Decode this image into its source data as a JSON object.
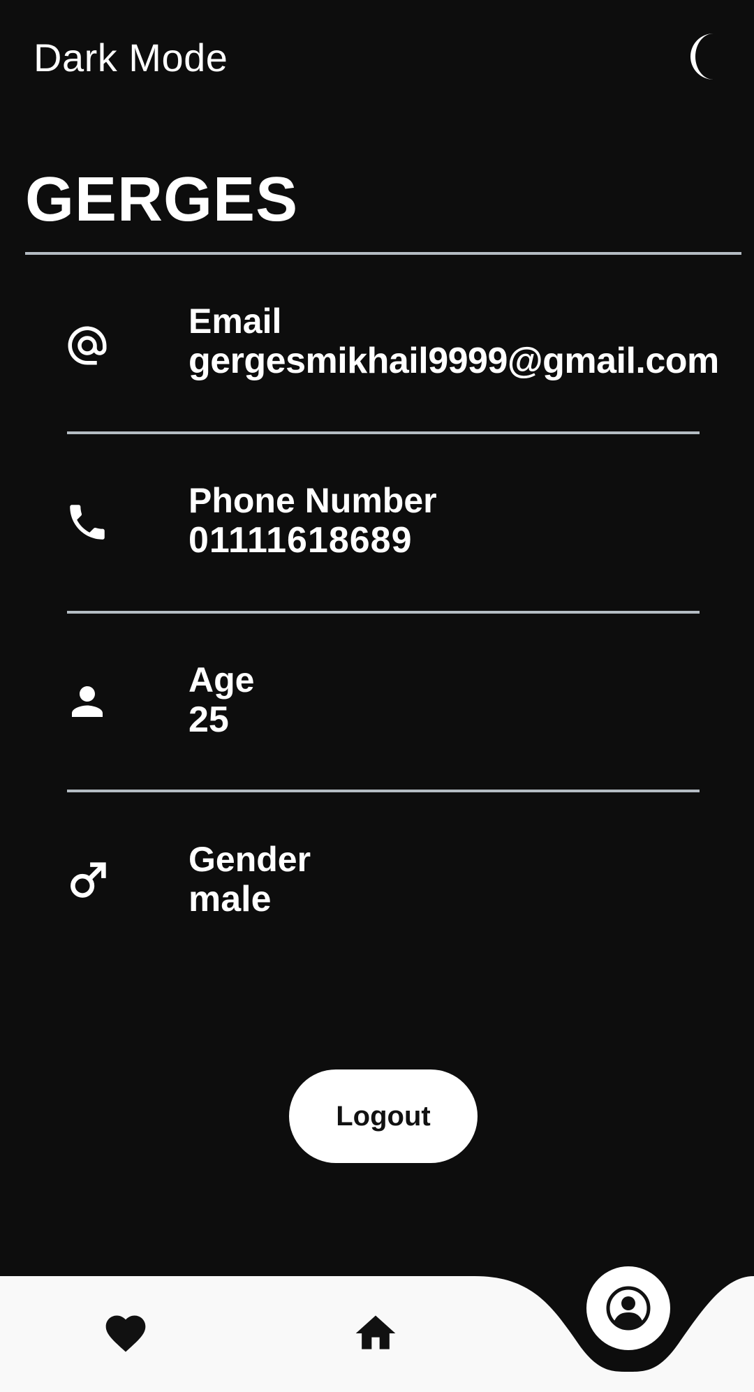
{
  "header": {
    "title": "Dark Mode",
    "toggle_icon": "moon-icon"
  },
  "profile": {
    "name": "GERGES"
  },
  "info": [
    {
      "label": "Email",
      "value": "gergesmikhail9999@gmail.com",
      "icon": "at-icon"
    },
    {
      "label": "Phone Number",
      "value": "01111618689",
      "icon": "phone-icon"
    },
    {
      "label": "Age",
      "value": "25",
      "icon": "person-icon"
    },
    {
      "label": "Gender",
      "value": "male",
      "icon": "male-icon"
    }
  ],
  "logout_label": "Logout",
  "bottom_nav": {
    "items": [
      {
        "icon": "heart-icon"
      },
      {
        "icon": "home-icon"
      },
      {
        "icon": "account-circle-icon",
        "active": true
      }
    ]
  },
  "colors": {
    "background": "#0d0d0d",
    "text": "#ffffff",
    "divider": "#b4bcc3",
    "nav_background": "#f9f9f9",
    "nav_icon": "#111111"
  }
}
